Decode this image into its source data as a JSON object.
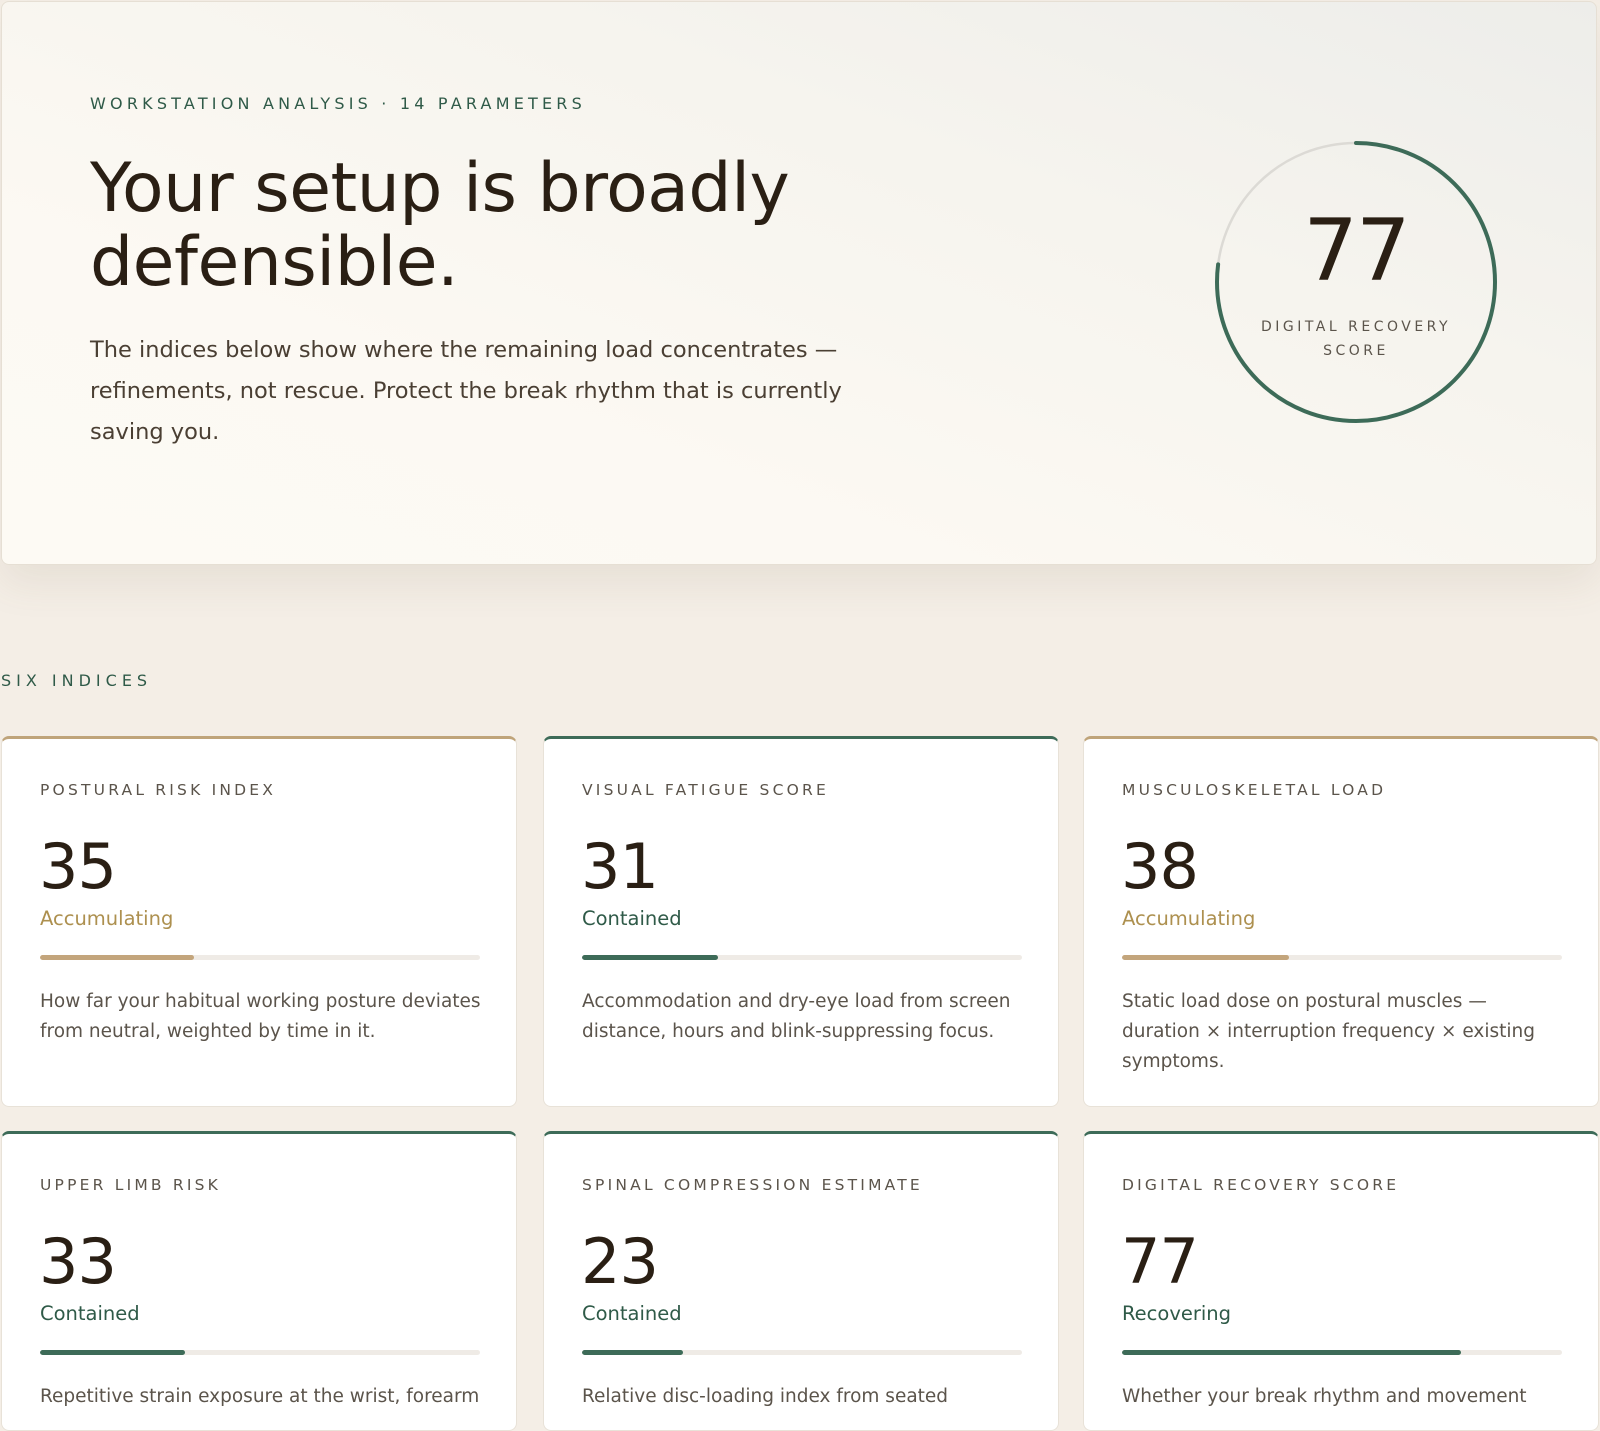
{
  "hero": {
    "eyebrow": "WORKSTATION ANALYSIS · 14 PARAMETERS",
    "title": "Your setup is broadly defensible.",
    "description": "The indices below show where the remaining load concentrates — refinements, not rescue. Protect the break rhythm that is currently saving you.",
    "score": {
      "value": "77",
      "fraction": 0.77,
      "label": "DIGITAL RECOVERY SCORE",
      "ring_color": "#3d6b58",
      "track_color": "#dcdad5"
    }
  },
  "section_label": "SIX INDICES",
  "colors": {
    "tan": "#bfa47a",
    "green": "#3d6b58"
  },
  "cards": [
    {
      "title": "POSTURAL RISK INDEX",
      "value": "35",
      "status": "Accumulating",
      "tone": "tan",
      "level": 0.35,
      "description": "How far your habitual working posture deviates from neutral, weighted by time in it."
    },
    {
      "title": "VISUAL FATIGUE SCORE",
      "value": "31",
      "status": "Contained",
      "tone": "green",
      "level": 0.31,
      "description": "Accommodation and dry-eye load from screen distance, hours and blink-suppressing focus."
    },
    {
      "title": "MUSCULOSKELETAL LOAD",
      "value": "38",
      "status": "Accumulating",
      "tone": "tan",
      "level": 0.38,
      "description": "Static load dose on postural muscles — duration × interruption frequency × existing symptoms."
    },
    {
      "title": "UPPER LIMB RISK",
      "value": "33",
      "status": "Contained",
      "tone": "green",
      "level": 0.33,
      "description": "Repetitive strain exposure at the wrist, forearm"
    },
    {
      "title": "SPINAL COMPRESSION ESTIMATE",
      "value": "23",
      "status": "Contained",
      "tone": "green",
      "level": 0.23,
      "description": "Relative disc-loading index from seated"
    },
    {
      "title": "DIGITAL RECOVERY SCORE",
      "value": "77",
      "status": "Recovering",
      "tone": "green",
      "level": 0.77,
      "description": "Whether your break rhythm and movement"
    }
  ]
}
